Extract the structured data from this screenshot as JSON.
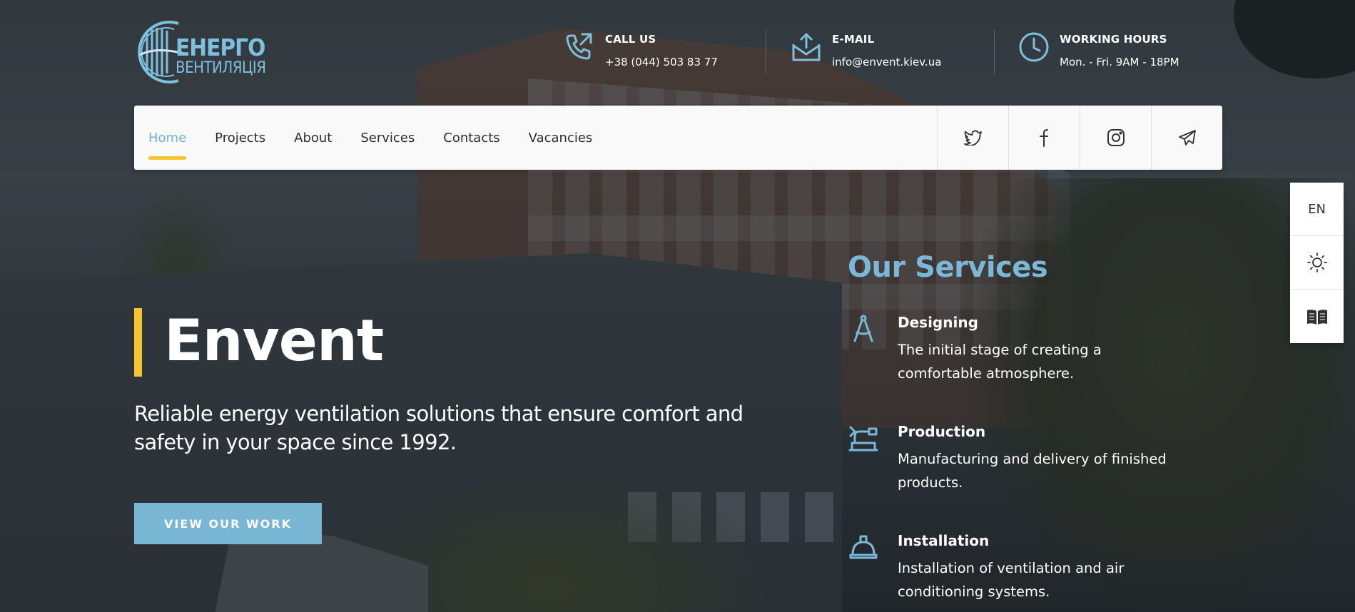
{
  "brand": {
    "logo_line1": "ЕНЕРГО",
    "logo_line2": "ВЕНТИЛЯЦІЯ",
    "color": "#7cc0dd"
  },
  "contacts": [
    {
      "label": "CALL US",
      "value": "+38 (044) 503 83 77",
      "icon": "phone-icon"
    },
    {
      "label": "E-MAIL",
      "value": "info@envent.kiev.ua",
      "icon": "email-icon"
    },
    {
      "label": "WORKING HOURS",
      "value": "Mon. - Fri. 9AM - 18PM",
      "icon": "clock-icon"
    }
  ],
  "nav": {
    "links": [
      {
        "label": "Home",
        "active": true
      },
      {
        "label": "Projects",
        "active": false
      },
      {
        "label": "About",
        "active": false
      },
      {
        "label": "Services",
        "active": false
      },
      {
        "label": "Contacts",
        "active": false
      },
      {
        "label": "Vacancies",
        "active": false
      }
    ],
    "social": [
      "twitter-icon",
      "facebook-icon",
      "instagram-icon",
      "telegram-icon"
    ]
  },
  "hero": {
    "title": "Envent",
    "subtitle": "Reliable energy ventilation solutions that ensure comfort and safety in your space since 1992.",
    "cta_label": "VIEW OUR WORK"
  },
  "services": {
    "title": "Our Services",
    "items": [
      {
        "name": "Designing",
        "desc": "The initial stage of creating a comfortable atmosphere.",
        "icon": "compass-icon"
      },
      {
        "name": "Production",
        "desc": "Manufacturing and delivery of finished products.",
        "icon": "machine-icon"
      },
      {
        "name": "Installation",
        "desc": "Installation of ventilation and air conditioning systems.",
        "icon": "hardhat-icon"
      }
    ]
  },
  "side_panel": {
    "language": "EN",
    "theme_icon": "sun-icon",
    "reader_icon": "book-icon"
  },
  "colors": {
    "accent_blue": "#79b6d4",
    "accent_yellow": "#f5c52c",
    "nav_bg": "#f9f9f9"
  }
}
